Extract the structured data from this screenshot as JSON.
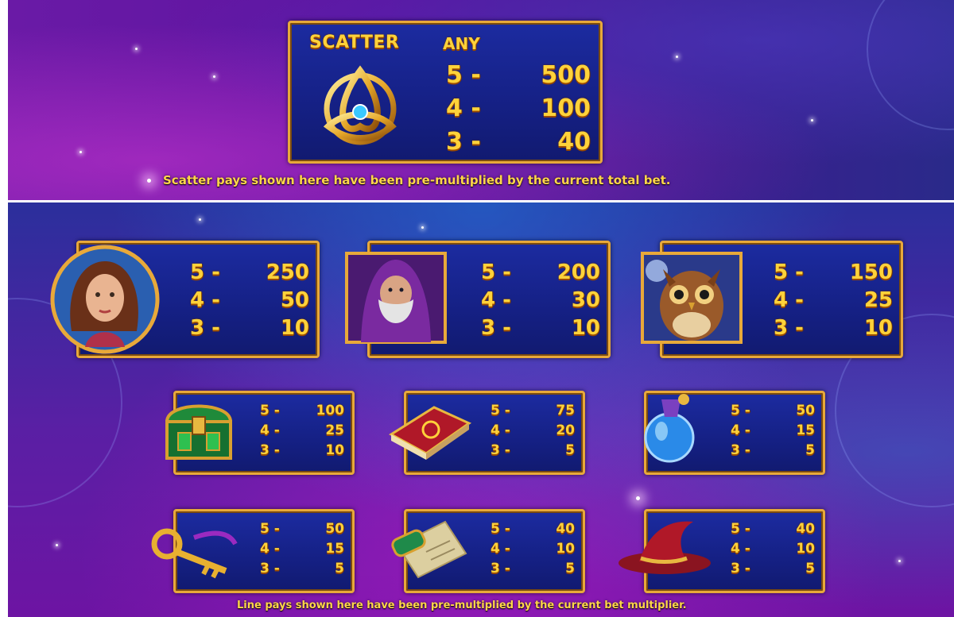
{
  "scatter": {
    "title": "SCATTER",
    "any_label": "ANY",
    "pays": [
      {
        "count": "5 -",
        "value": "500"
      },
      {
        "count": "4 -",
        "value": "100"
      },
      {
        "count": "3 -",
        "value": "40"
      }
    ],
    "note": "Scatter pays shown here have been pre-multiplied by the current total bet.",
    "symbol_icon": "triquetra-scatter-icon"
  },
  "line_pays": {
    "note": "Line pays shown here have been pre-multiplied by the current bet multiplier.",
    "symbols": [
      {
        "icon": "sorceress-portrait-icon",
        "pays": [
          {
            "count": "5 -",
            "value": "250"
          },
          {
            "count": "4 -",
            "value": "50"
          },
          {
            "count": "3 -",
            "value": "10"
          }
        ]
      },
      {
        "icon": "wizard-portrait-icon",
        "pays": [
          {
            "count": "5 -",
            "value": "200"
          },
          {
            "count": "4 -",
            "value": "30"
          },
          {
            "count": "3 -",
            "value": "10"
          }
        ]
      },
      {
        "icon": "owl-icon",
        "pays": [
          {
            "count": "5 -",
            "value": "150"
          },
          {
            "count": "4 -",
            "value": "25"
          },
          {
            "count": "3 -",
            "value": "10"
          }
        ]
      },
      {
        "icon": "treasure-chest-icon",
        "pays": [
          {
            "count": "5 -",
            "value": "100"
          },
          {
            "count": "4 -",
            "value": "25"
          },
          {
            "count": "3 -",
            "value": "10"
          }
        ]
      },
      {
        "icon": "spell-book-icon",
        "pays": [
          {
            "count": "5 -",
            "value": "75"
          },
          {
            "count": "4 -",
            "value": "20"
          },
          {
            "count": "3 -",
            "value": "5"
          }
        ]
      },
      {
        "icon": "potion-bottle-icon",
        "pays": [
          {
            "count": "5 -",
            "value": "50"
          },
          {
            "count": "4 -",
            "value": "15"
          },
          {
            "count": "3 -",
            "value": "5"
          }
        ]
      },
      {
        "icon": "golden-key-icon",
        "pays": [
          {
            "count": "5 -",
            "value": "50"
          },
          {
            "count": "4 -",
            "value": "15"
          },
          {
            "count": "3 -",
            "value": "5"
          }
        ]
      },
      {
        "icon": "scroll-icon",
        "pays": [
          {
            "count": "5 -",
            "value": "40"
          },
          {
            "count": "4 -",
            "value": "10"
          },
          {
            "count": "3 -",
            "value": "5"
          }
        ]
      },
      {
        "icon": "wizard-hat-icon",
        "pays": [
          {
            "count": "5 -",
            "value": "40"
          },
          {
            "count": "4 -",
            "value": "10"
          },
          {
            "count": "3 -",
            "value": "5"
          }
        ]
      }
    ]
  },
  "colors": {
    "gold": "#ffd23a",
    "box_blue": "#152084",
    "frame": "#e8a93a"
  }
}
